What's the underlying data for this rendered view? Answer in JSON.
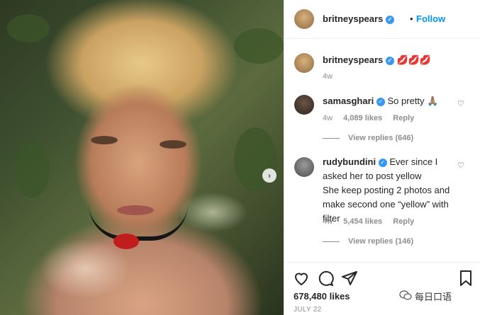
{
  "post": {
    "username": "britneyspears",
    "follow_label": "Follow",
    "more": "•••",
    "caption": "💋💋💋",
    "caption_time": "4w"
  },
  "comments": [
    {
      "username": "samasghari",
      "text": "So pretty 🙏🏽",
      "time": "4w",
      "likes": "4,089 likes",
      "reply": "Reply",
      "view_replies": "View replies (646)"
    },
    {
      "username": "rudybundini",
      "lines": [
        "Ever since I",
        "asked her to post yellow",
        "She keep posting 2 photos and",
        "make second one “yellow” with",
        "filter"
      ],
      "time": "4w",
      "likes": "5,454 likes",
      "reply": "Reply",
      "view_replies": "View replies (146)"
    }
  ],
  "footer": {
    "likes": "678,480 likes",
    "date": "JULY 22"
  },
  "watermark": "每日口语",
  "icons": [
    "heart-icon",
    "comment-icon",
    "share-icon",
    "bookmark-icon",
    "next-arrow-icon",
    "verified-icon"
  ]
}
